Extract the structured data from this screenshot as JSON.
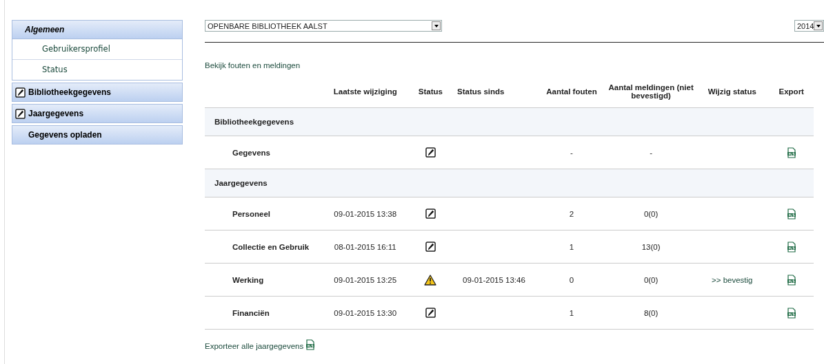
{
  "sidebar": {
    "items": [
      {
        "label": "Algemeen",
        "selected": true,
        "editable": false,
        "children": [
          {
            "label": "Gebruikersprofiel"
          },
          {
            "label": "Status"
          }
        ]
      },
      {
        "label": "Bibliotheekgegevens",
        "selected": false,
        "editable": true
      },
      {
        "label": "Jaargegevens",
        "selected": false,
        "editable": true
      },
      {
        "label": "Gegevens opladen",
        "selected": false,
        "editable": false
      }
    ]
  },
  "library_select": {
    "value": "OPENBARE BIBLIOTHEEK AALST"
  },
  "year_select": {
    "value": "2014"
  },
  "errors_link": "Bekijk fouten en meldingen",
  "table": {
    "columns": [
      "",
      "Laatste wijziging",
      "Status",
      "Status sinds",
      "Aantal fouten",
      "Aantal meldingen (niet bevestigd)",
      "Wijzig status",
      "Export"
    ],
    "rows": [
      {
        "kind": "group",
        "name": "Bibliotheekgegevens"
      },
      {
        "kind": "item",
        "name": "Gegevens",
        "changed": "",
        "warning": false,
        "since": "",
        "errors": "-",
        "notices": "-",
        "action": ""
      },
      {
        "kind": "group",
        "name": "Jaargegevens"
      },
      {
        "kind": "item",
        "name": "Personeel",
        "changed": "09-01-2015 13:38",
        "warning": false,
        "since": "",
        "errors": "2",
        "notices": "0(0)",
        "action": ""
      },
      {
        "kind": "item",
        "name": "Collectie en Gebruik",
        "changed": "08-01-2015 16:11",
        "warning": false,
        "since": "",
        "errors": "1",
        "notices": "13(0)",
        "action": ""
      },
      {
        "kind": "item",
        "name": "Werking",
        "changed": "09-01-2015 13:25",
        "warning": true,
        "since": "09-01-2015 13:46",
        "errors": "0",
        "notices": "0(0)",
        "action": ">> bevestig"
      },
      {
        "kind": "item",
        "name": "Financiën",
        "changed": "09-01-2015 13:30",
        "warning": false,
        "since": "",
        "errors": "1",
        "notices": "8(0)",
        "action": ""
      }
    ]
  },
  "export_all_link": "Exporteer alle jaargegevens"
}
